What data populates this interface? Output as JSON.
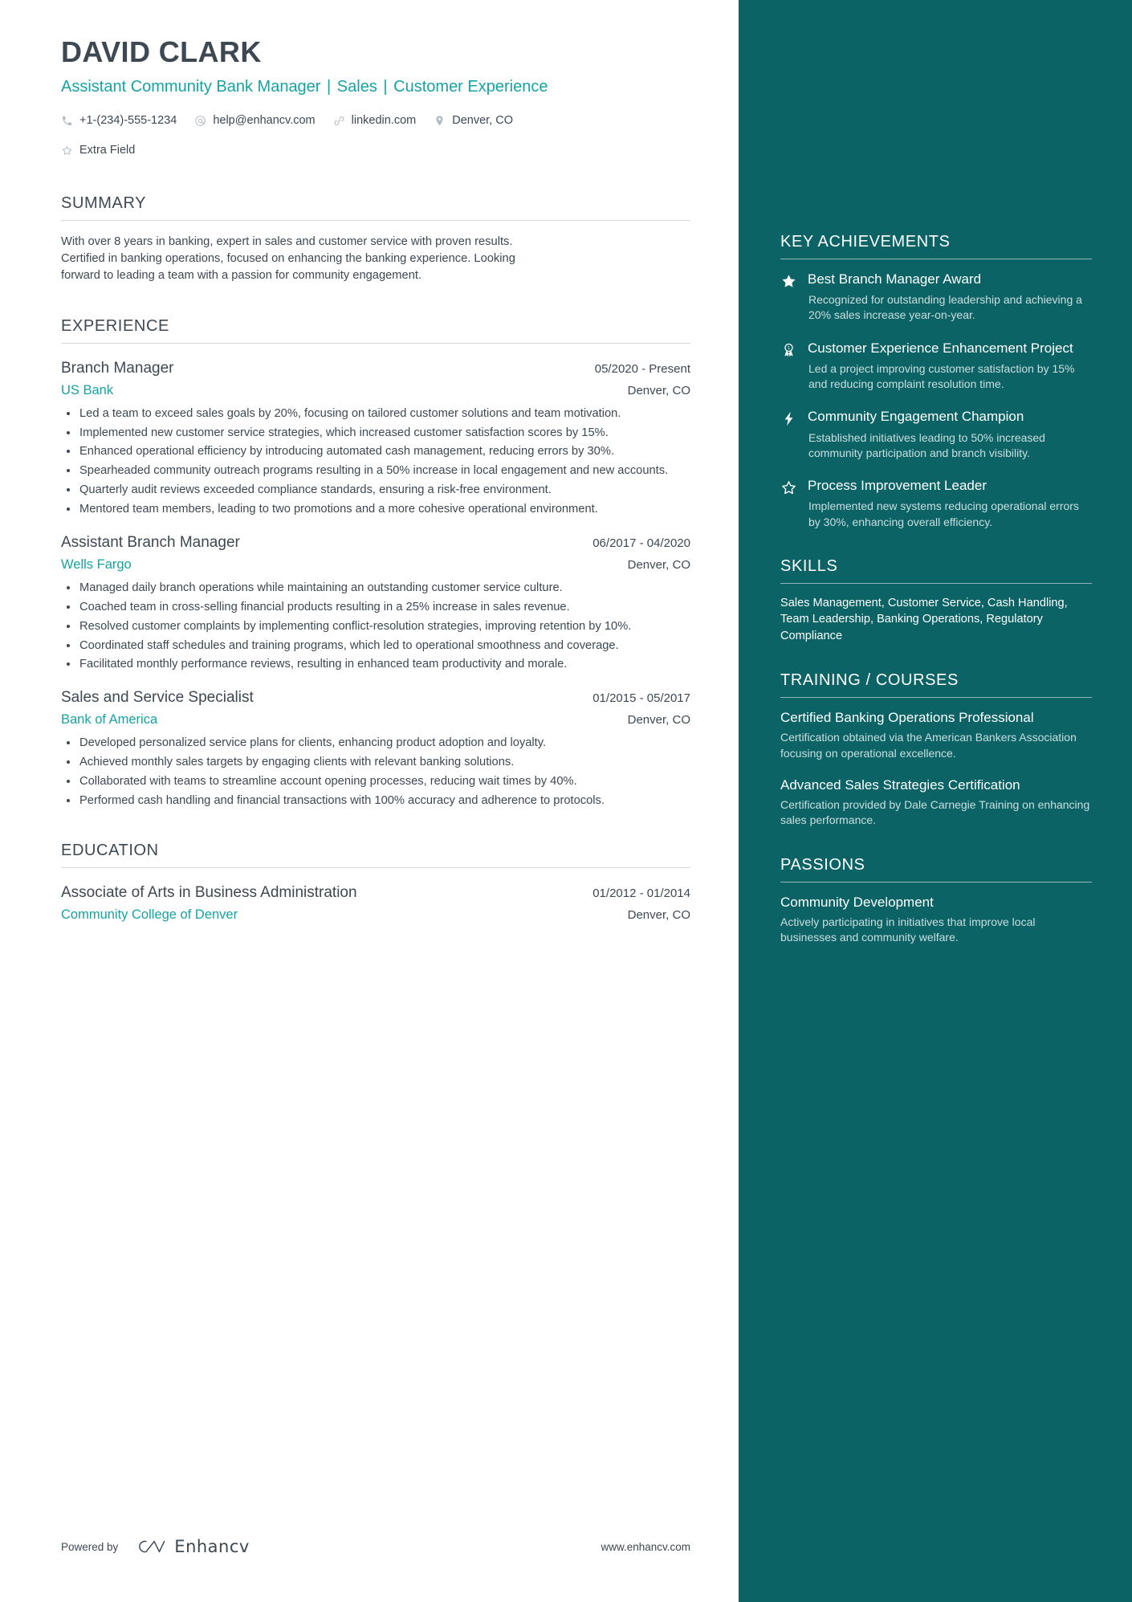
{
  "colors": {
    "accent": "#16a3a3",
    "sidebar_bg": "#0b6366",
    "text": "#3d4853"
  },
  "header": {
    "name": "DAVID CLARK",
    "headline_part1": "Assistant Community Bank Manager",
    "headline_sep1": "|",
    "headline_part2": "Sales",
    "headline_sep2": "|",
    "headline_part3": "Customer Experience",
    "contacts": [
      {
        "icon": "phone-icon",
        "text": "+1-(234)-555-1234"
      },
      {
        "icon": "email-icon",
        "text": "help@enhancv.com"
      },
      {
        "icon": "link-icon",
        "text": "linkedin.com"
      },
      {
        "icon": "location-icon",
        "text": "Denver, CO"
      },
      {
        "icon": "star-outline-icon",
        "text": "Extra Field"
      }
    ]
  },
  "summary": {
    "title": "SUMMARY",
    "text": "With over 8 years in banking, expert in sales and customer service with proven results. Certified in banking operations, focused on enhancing the banking experience. Looking forward to leading a team with a passion for community engagement."
  },
  "experience": {
    "title": "EXPERIENCE",
    "entries": [
      {
        "role": "Branch Manager",
        "date": "05/2020 - Present",
        "company": "US Bank",
        "location": "Denver, CO",
        "bullets": [
          "Led a team to exceed sales goals by 20%, focusing on tailored customer solutions and team motivation.",
          "Implemented new customer service strategies, which increased customer satisfaction scores by 15%.",
          "Enhanced operational efficiency by introducing automated cash management, reducing errors by 30%.",
          "Spearheaded community outreach programs resulting in a 50% increase in local engagement and new accounts.",
          "Quarterly audit reviews exceeded compliance standards, ensuring a risk-free environment.",
          "Mentored team members, leading to two promotions and a more cohesive operational environment."
        ]
      },
      {
        "role": "Assistant Branch Manager",
        "date": "06/2017 - 04/2020",
        "company": "Wells Fargo",
        "location": "Denver, CO",
        "bullets": [
          "Managed daily branch operations while maintaining an outstanding customer service culture.",
          "Coached team in cross-selling financial products resulting in a 25% increase in sales revenue.",
          "Resolved customer complaints by implementing conflict-resolution strategies, improving retention by 10%.",
          "Coordinated staff schedules and training programs, which led to operational smoothness and coverage.",
          "Facilitated monthly performance reviews, resulting in enhanced team productivity and morale."
        ]
      },
      {
        "role": "Sales and Service Specialist",
        "date": "01/2015 - 05/2017",
        "company": "Bank of America",
        "location": "Denver, CO",
        "bullets": [
          "Developed personalized service plans for clients, enhancing product adoption and loyalty.",
          "Achieved monthly sales targets by engaging clients with relevant banking solutions.",
          "Collaborated with teams to streamline account opening processes, reducing wait times by 40%.",
          "Performed cash handling and financial transactions with 100% accuracy and adherence to protocols."
        ]
      }
    ]
  },
  "education": {
    "title": "EDUCATION",
    "entries": [
      {
        "degree": "Associate of Arts in Business Administration",
        "date": "01/2012 - 01/2014",
        "school": "Community College of Denver",
        "location": "Denver, CO"
      }
    ]
  },
  "footer": {
    "powered_by": "Powered by",
    "brand": "Enhancv",
    "website": "www.enhancv.com"
  },
  "sidebar": {
    "achievements": {
      "title": "KEY ACHIEVEMENTS",
      "items": [
        {
          "icon": "star-filled-icon",
          "title": "Best Branch Manager Award",
          "desc": "Recognized for outstanding leadership and achieving a 20% sales increase year-on-year."
        },
        {
          "icon": "award-medal-icon",
          "title": "Customer Experience Enhancement Project",
          "desc": "Led a project improving customer satisfaction by 15% and reducing complaint resolution time."
        },
        {
          "icon": "lightning-bolt-icon",
          "title": "Community Engagement Champion",
          "desc": "Established initiatives leading to 50% increased community participation and branch visibility."
        },
        {
          "icon": "star-outline-icon",
          "title": "Process Improvement Leader",
          "desc": "Implemented new systems reducing operational errors by 30%, enhancing overall efficiency."
        }
      ]
    },
    "skills": {
      "title": "SKILLS",
      "text": "Sales Management, Customer Service, Cash Handling, Team Leadership, Banking Operations, Regulatory Compliance"
    },
    "training": {
      "title": "TRAINING / COURSES",
      "items": [
        {
          "title": "Certified Banking Operations Professional",
          "desc": "Certification obtained via the American Bankers Association focusing on operational excellence."
        },
        {
          "title": "Advanced Sales Strategies Certification",
          "desc": "Certification provided by Dale Carnegie Training on enhancing sales performance."
        }
      ]
    },
    "passions": {
      "title": "PASSIONS",
      "items": [
        {
          "title": "Community Development",
          "desc": "Actively participating in initiatives that improve local businesses and community welfare."
        }
      ]
    }
  }
}
